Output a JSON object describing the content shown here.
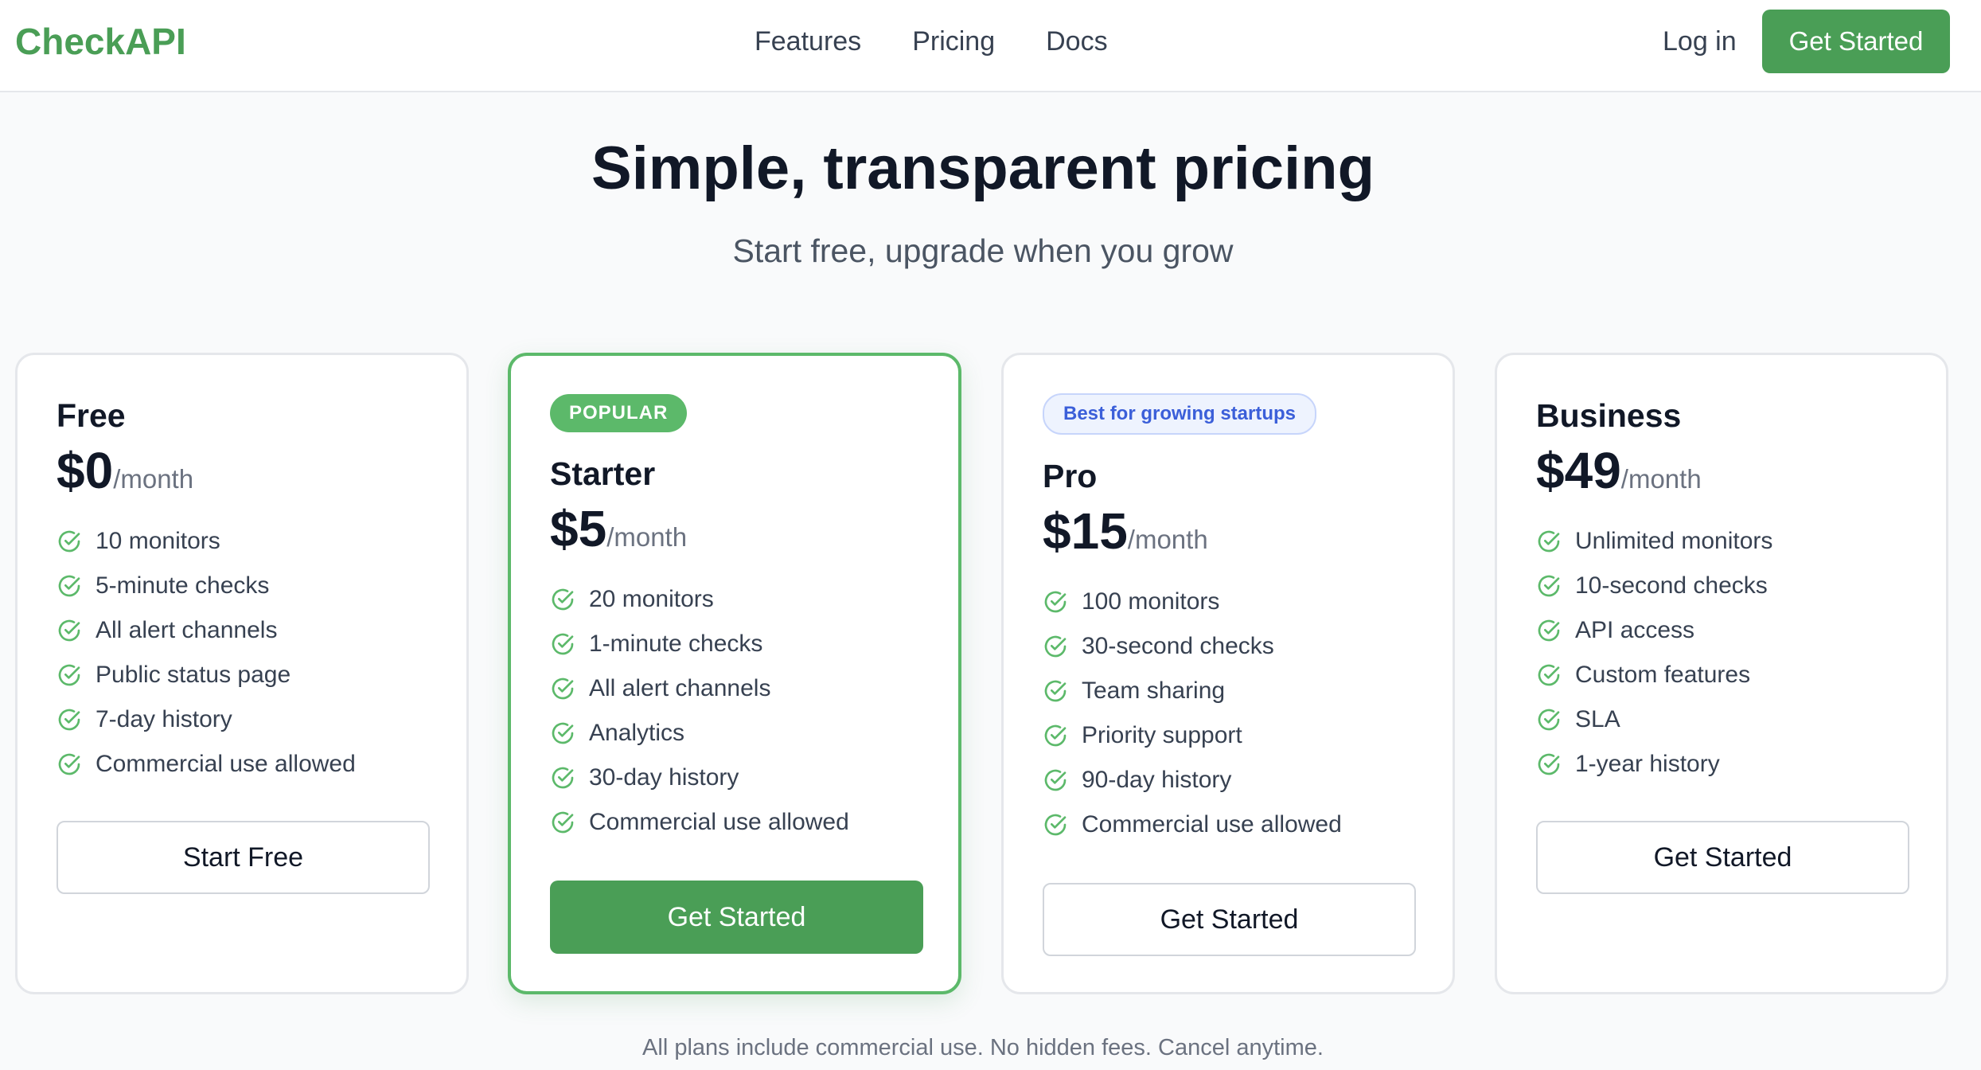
{
  "header": {
    "logo": "CheckAPI",
    "nav": [
      {
        "label": "Features"
      },
      {
        "label": "Pricing"
      },
      {
        "label": "Docs"
      }
    ],
    "login_label": "Log in",
    "cta_label": "Get Started"
  },
  "hero": {
    "title": "Simple, transparent pricing",
    "subtitle": "Start free, upgrade when you grow"
  },
  "plans": [
    {
      "name": "Free",
      "badge": "",
      "price": "$0",
      "period": "/month",
      "features": [
        "10 monitors",
        "5-minute checks",
        "All alert channels",
        "Public status page",
        "7-day history",
        "Commercial use allowed"
      ],
      "button": "Start Free"
    },
    {
      "name": "Starter",
      "badge": "POPULAR",
      "price": "$5",
      "period": "/month",
      "features": [
        "20 monitors",
        "1-minute checks",
        "All alert channels",
        "Analytics",
        "30-day history",
        "Commercial use allowed"
      ],
      "button": "Get Started"
    },
    {
      "name": "Pro",
      "badge": "Best for growing startups",
      "price": "$15",
      "period": "/month",
      "features": [
        "100 monitors",
        "30-second checks",
        "Team sharing",
        "Priority support",
        "90-day history",
        "Commercial use allowed"
      ],
      "button": "Get Started"
    },
    {
      "name": "Business",
      "badge": "",
      "price": "$49",
      "period": "/month",
      "features": [
        "Unlimited monitors",
        "10-second checks",
        "API access",
        "Custom features",
        "SLA",
        "1-year history"
      ],
      "button": "Get Started"
    }
  ],
  "footer_note": "All plans include commercial use. No hidden fees. Cancel anytime.",
  "icons": {
    "feature": "check-circle-icon"
  },
  "colors": {
    "brand": "#4a9e56",
    "popular_border": "#5cb96a",
    "badge_blue_text": "#3b5fd9",
    "badge_blue_bg": "#eef3fe"
  }
}
